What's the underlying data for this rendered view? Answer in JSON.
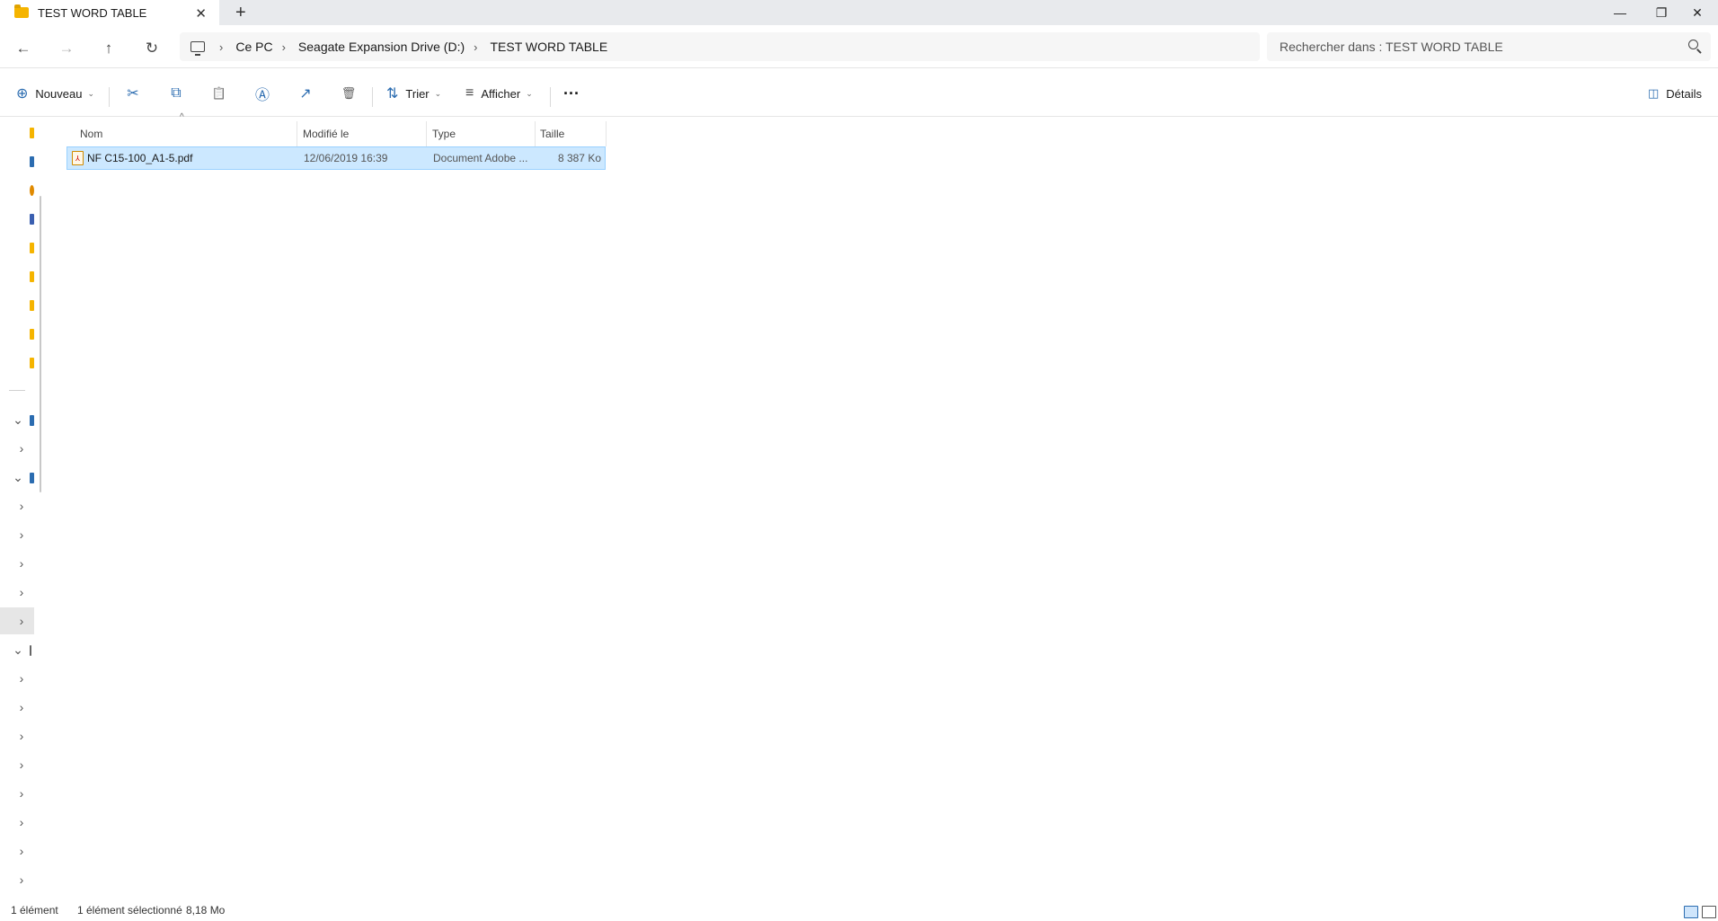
{
  "window": {
    "tab_title": "TEST WORD TABLE",
    "tab_close": "✕",
    "new_tab": "+",
    "minimize": "—",
    "restore": "❐",
    "close": "✕"
  },
  "nav": {
    "back_icon": "←",
    "forward_icon": "→",
    "up_icon": "↑",
    "refresh_icon": "↻",
    "sep": "›"
  },
  "breadcrumb": [
    "Ce PC",
    "Seagate Expansion Drive (D:)",
    "TEST WORD TABLE"
  ],
  "search": {
    "placeholder": "Rechercher dans : TEST WORD TABLE"
  },
  "commands": {
    "new_label": "Nouveau",
    "sort_label": "Trier",
    "view_label": "Afficher",
    "more_label": "···",
    "details_label": "Détails",
    "cut_icon": "✂",
    "copy_icon": "⧉",
    "paste_icon": "📋",
    "rename_icon": "Ⓐ",
    "share_icon": "↗",
    "delete_icon": "🗑",
    "new_icon": "⊕",
    "sort_icon": "⇅",
    "view_icon": "≡",
    "chevron": "⌄"
  },
  "columns": {
    "name": "Nom",
    "modified": "Modifié le",
    "type": "Type",
    "size": "Taille",
    "sort_caret": "^"
  },
  "files": [
    {
      "name": "NF C15-100_A1-5.pdf",
      "modified": "12/06/2019 16:39",
      "type": "Document Adobe ...",
      "size": "8 387 Ko",
      "selected": true
    }
  ],
  "status": {
    "count": "1 élément",
    "selection": "1 élément sélectionné",
    "selection_size": "8,18 Mo"
  },
  "colors": {
    "selection_bg": "#cce8ff",
    "selection_border": "#99d1ff",
    "accent": "#2b6cb0",
    "folder": "#f5b400"
  }
}
